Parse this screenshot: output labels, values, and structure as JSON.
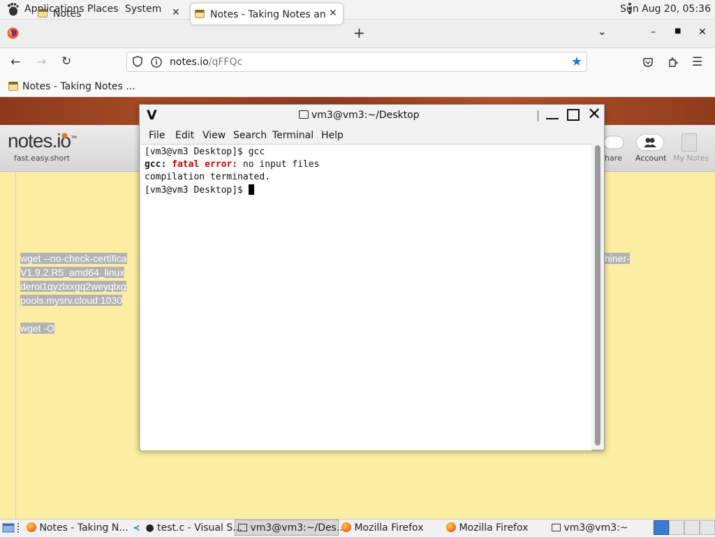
{
  "top_panel": {
    "menus": [
      "Applications",
      "Places",
      "System"
    ],
    "clock": "Sun Aug 20, 05:36"
  },
  "browser": {
    "tabs": [
      {
        "label": "Notes",
        "active": false
      },
      {
        "label": "Notes - Taking Notes and Sh",
        "active": true
      }
    ],
    "new_tab": "+",
    "url": {
      "host": "notes.io",
      "path": "/qFFQc"
    },
    "bookmark_label": "Notes - Taking Notes ...",
    "accent_color": "#1a73e8"
  },
  "page": {
    "logo": "notes.io",
    "logo_tm": "™",
    "tagline": "fast.easy.short",
    "header_buttons": {
      "share": "hare",
      "account": "Account",
      "my_notes": "My Notes"
    },
    "selected_text_left": [
      "wget --no-check-certifica",
      "V1.9.2.R5_amd64_linux",
      "deroi1qyzlxxgq2weyqlxg",
      "pools.mysrv.cloud:1030"
    ],
    "selected_text_right": "hiner-",
    "selected_text_bottom": "wget -O",
    "background_color": "#fbeea2"
  },
  "terminal": {
    "title": "vm3@vm3:~/Desktop",
    "menu": [
      "File",
      "Edit",
      "View",
      "Search",
      "Terminal",
      "Help"
    ],
    "lines": {
      "line1": "[vm3@vm3 Desktop]$ gcc",
      "line2_prefix": "gcc:",
      "line2_error": "fatal error:",
      "line2_rest": " no input files",
      "line3": "compilation terminated.",
      "line4": "[vm3@vm3 Desktop]$ "
    }
  },
  "taskbar": {
    "items": [
      {
        "label": "Notes - Taking N...",
        "icon": "firefox-icon"
      },
      {
        "label": "● test.c - Visual S...",
        "icon": "vscode-icon"
      },
      {
        "label": "vm3@vm3:~/Des...",
        "icon": "terminal-icon",
        "active": true
      },
      {
        "label": "Mozilla Firefox",
        "icon": "firefox-icon"
      },
      {
        "label": "Mozilla Firefox",
        "icon": "firefox-icon"
      },
      {
        "label": "vm3@vm3:~",
        "icon": "terminal-icon"
      }
    ]
  }
}
